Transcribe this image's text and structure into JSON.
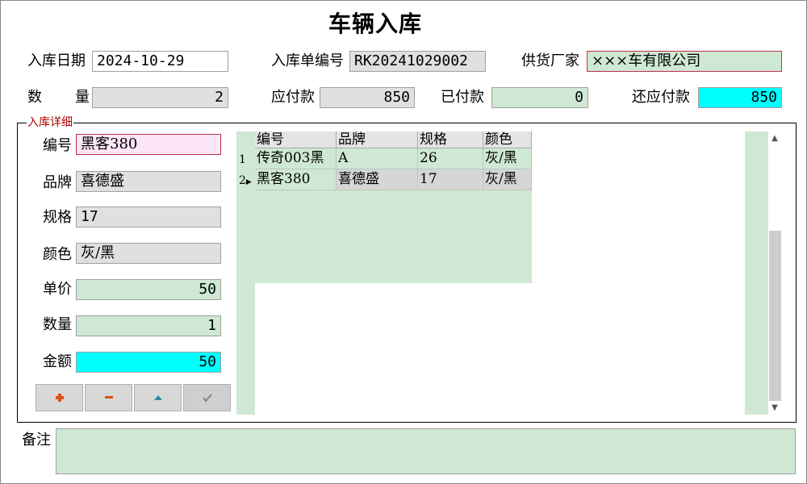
{
  "title": "车辆入库",
  "header": {
    "date_label": "入库日期",
    "date_value": "2024-10-29",
    "order_label": "入库单编号",
    "order_value": "RK20241029002",
    "supplier_label": "供货厂家",
    "supplier_value": "×××车有限公司",
    "qty_label_a": "数",
    "qty_label_b": "量",
    "qty_value": "2",
    "payable_label": "应付款",
    "payable_value": "850",
    "paid_label": "已付款",
    "paid_value": "0",
    "remaining_label": "还应付款",
    "remaining_value": "850"
  },
  "detail": {
    "group_label": "入库详细",
    "code_label": "编号",
    "code_value": "黑客380",
    "brand_label": "品牌",
    "brand_value": "喜德盛",
    "spec_label": "规格",
    "spec_value": "17",
    "color_label": "颜色",
    "color_value": "灰/黑",
    "price_label": "单价",
    "price_value": "50",
    "qty_label": "数量",
    "qty_value": "1",
    "amount_label": "金额",
    "amount_value": "50",
    "buttons": [
      "plus-icon",
      "minus-icon",
      "triangle-up-icon",
      "check-icon"
    ]
  },
  "grid": {
    "columns": [
      "编号",
      "品牌",
      "规格",
      "颜色"
    ],
    "rows": [
      {
        "num": "1",
        "code": "传奇003黑",
        "brand": "A",
        "spec": "26",
        "color": "灰/黑"
      },
      {
        "num": "2",
        "code": "黑客380",
        "brand": "喜德盛",
        "spec": "17",
        "color": "灰/黑"
      }
    ]
  },
  "notes": {
    "label": "备注",
    "value": ""
  },
  "colors": {
    "green_field": "#cfe8d3",
    "cyan_field": "#00ffff",
    "gray_field": "#e0e0e0",
    "pink_field": "#fce6f7",
    "alert_border": "#c0304a",
    "group_label": "#b00000"
  }
}
